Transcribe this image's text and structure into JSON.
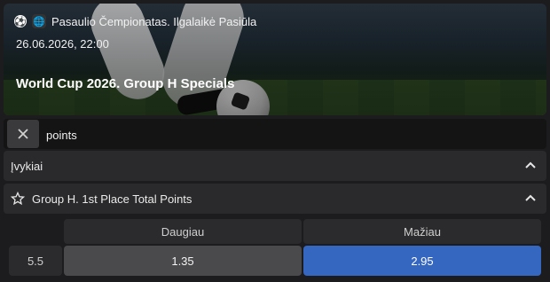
{
  "hero": {
    "breadcrumb": "Pasaulio Čempionatas. Ilgalaikė Pasiūla",
    "datetime": "26.06.2026, 22:00",
    "title": "World Cup 2026. Group H Specials",
    "icons": [
      "soccer-ball-icon",
      "globe-icon"
    ]
  },
  "search": {
    "value": "points",
    "clear_icon": "close-icon"
  },
  "sections": [
    {
      "label": "Įvykiai",
      "expanded": true
    },
    {
      "label": "Group H. 1st Place Total Points",
      "expanded": true,
      "icon": "star-icon"
    }
  ],
  "market": {
    "headers": [
      "Daugiau",
      "Mažiau"
    ],
    "line": "5.5",
    "odds": [
      {
        "value": "1.35",
        "selected": false
      },
      {
        "value": "2.95",
        "selected": true
      }
    ],
    "colors": {
      "selected": "#3566c0",
      "odd": "#4a4a4c"
    }
  }
}
